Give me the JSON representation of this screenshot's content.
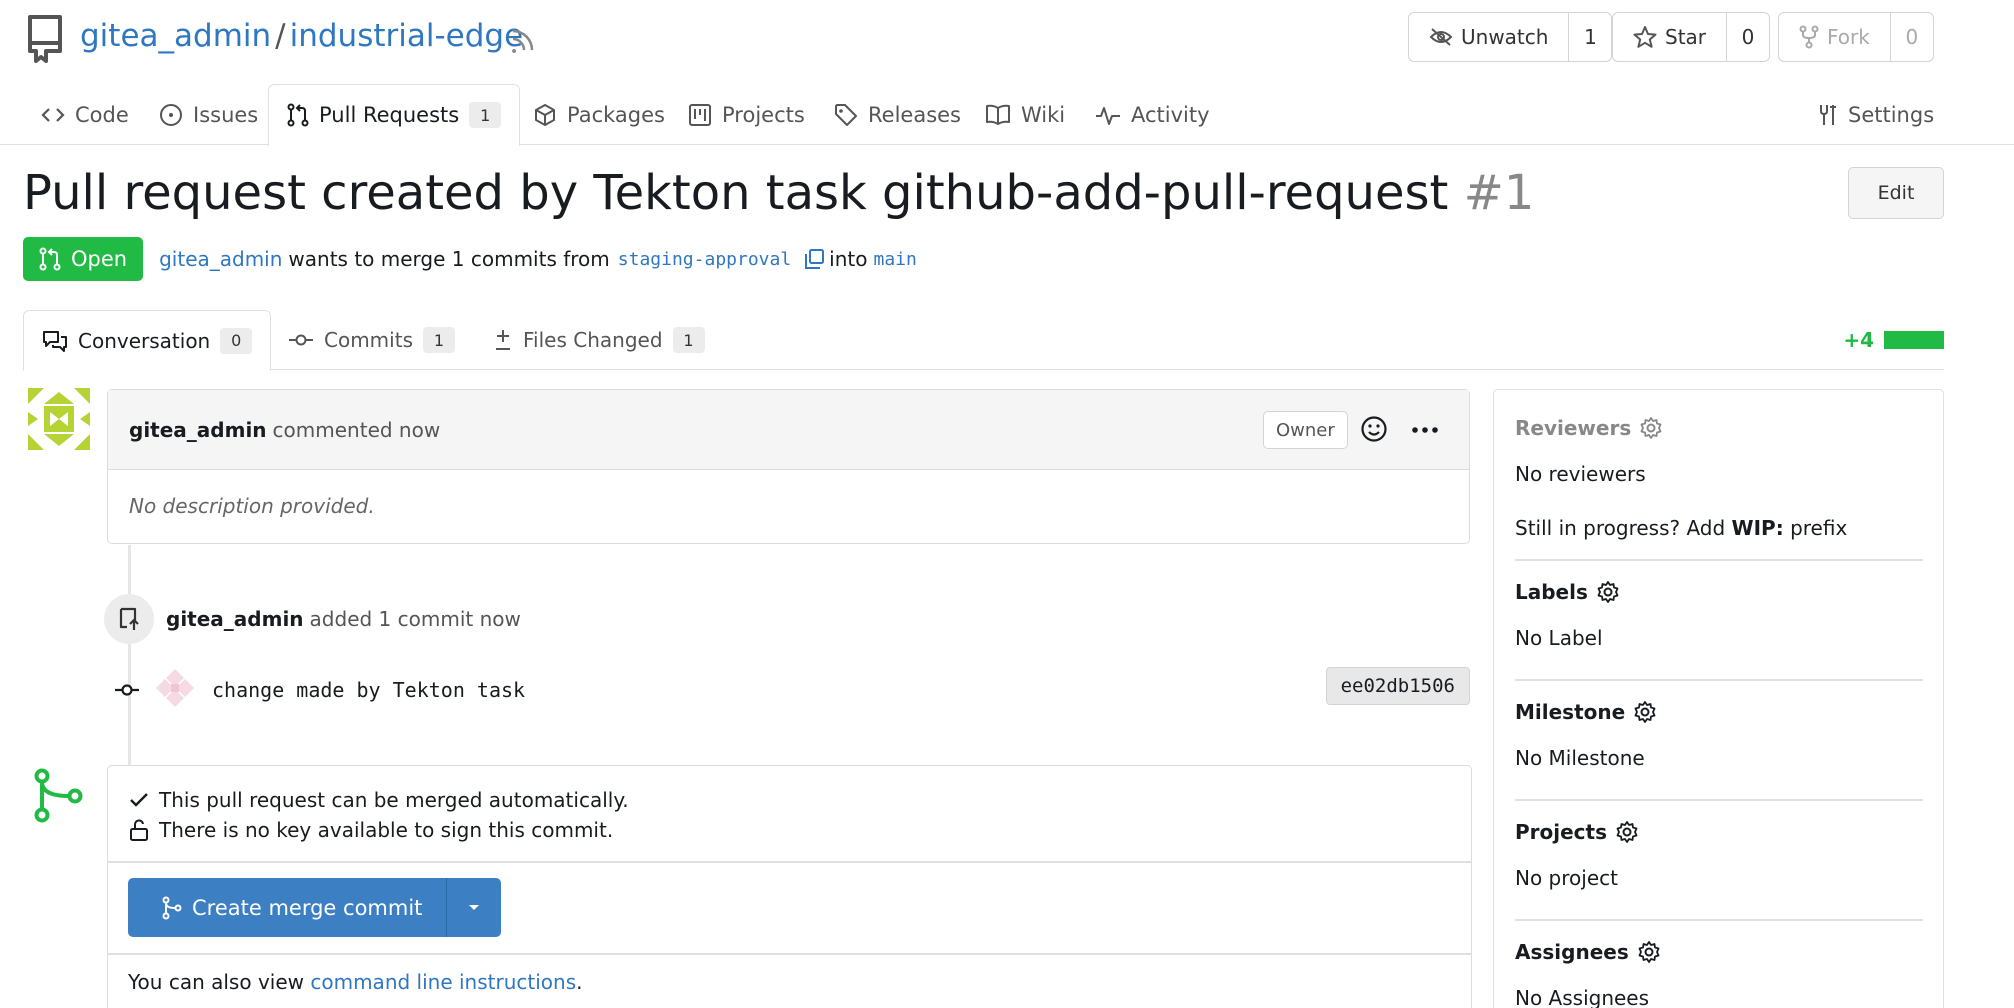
{
  "repo": {
    "owner": "gitea_admin",
    "separator": "/",
    "name": "industrial-edge",
    "watch": {
      "label": "Unwatch",
      "count": "1"
    },
    "star": {
      "label": "Star",
      "count": "0"
    },
    "fork": {
      "label": "Fork",
      "count": "0"
    }
  },
  "tabs": {
    "code": "Code",
    "issues": "Issues",
    "pulls": "Pull Requests",
    "pulls_count": "1",
    "packages": "Packages",
    "projects": "Projects",
    "releases": "Releases",
    "wiki": "Wiki",
    "activity": "Activity",
    "settings": "Settings"
  },
  "pr": {
    "title": "Pull request created by Tekton task github-add-pull-request",
    "number": "#1",
    "edit": "Edit",
    "status": "Open",
    "author": "gitea_admin",
    "merge_text": "wants to merge 1 commits from",
    "head_branch": "staging-approval",
    "into": "into",
    "base_branch": "main"
  },
  "pr_tabs": {
    "conversation": "Conversation",
    "conversation_count": "0",
    "commits": "Commits",
    "commits_count": "1",
    "files": "Files Changed",
    "files_count": "1",
    "diffstat": "+4"
  },
  "comment": {
    "author": "gitea_admin",
    "action": "commented now",
    "role": "Owner",
    "body": "No description provided."
  },
  "event": {
    "author": "gitea_admin",
    "action": "added 1 commit now"
  },
  "commit": {
    "message": "change made by Tekton task",
    "sha": "ee02db1506"
  },
  "merge": {
    "check1": "This pull request can be merged automatically.",
    "check2": "There is no key available to sign this commit.",
    "button": "Create merge commit",
    "cli_prefix": "You can also view",
    "cli_link": "command line instructions",
    "cli_suffix": "."
  },
  "sidebar": {
    "reviewers": "Reviewers",
    "no_reviewers": "No reviewers",
    "wip_prefix": "Still in progress? Add",
    "wip_bold": "WIP:",
    "wip_suffix": "prefix",
    "labels": "Labels",
    "no_label": "No Label",
    "milestone": "Milestone",
    "no_milestone": "No Milestone",
    "projects": "Projects",
    "no_project": "No project",
    "assignees": "Assignees",
    "no_assignees": "No Assignees"
  },
  "colors": {
    "link": "#2f78c1",
    "open_green": "#21ba45",
    "primary_blue": "#3c7fc3"
  }
}
